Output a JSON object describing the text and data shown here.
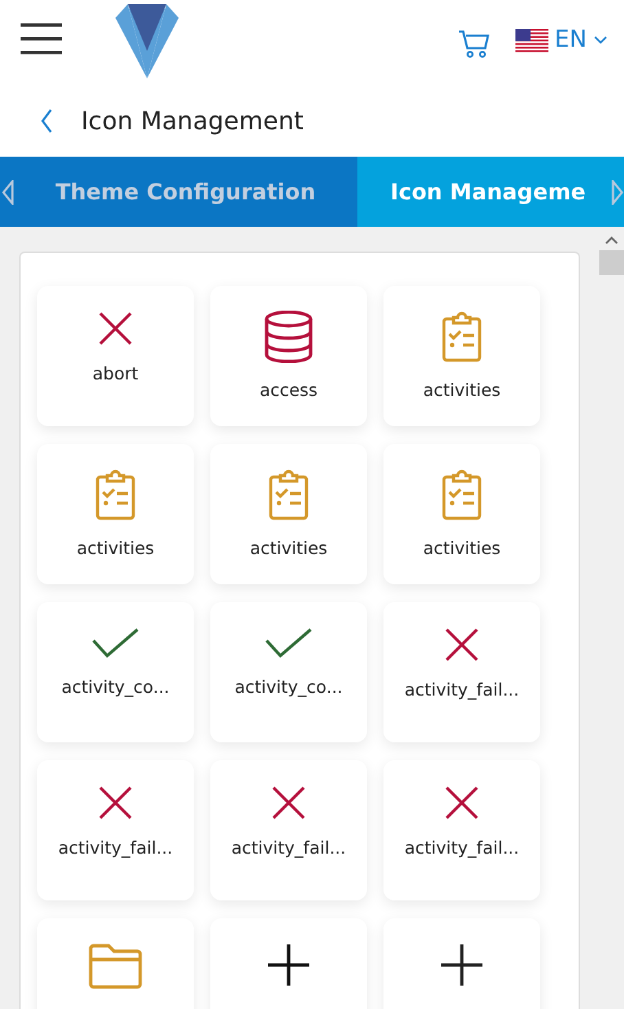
{
  "header": {
    "language": "EN"
  },
  "breadcrumb": {
    "title": "Icon Management"
  },
  "tabs": [
    {
      "label": "Theme Configuration",
      "selected": false
    },
    {
      "label": "Icon Manageme",
      "selected": true
    }
  ],
  "icons": [
    {
      "kind": "cross",
      "color": "#b5103c",
      "label": "abort"
    },
    {
      "kind": "database",
      "color": "#b5103c",
      "label": "access"
    },
    {
      "kind": "clipboard",
      "color": "#d4982a",
      "label": "activities"
    },
    {
      "kind": "clipboard",
      "color": "#d4982a",
      "label": "activities"
    },
    {
      "kind": "clipboard",
      "color": "#d4982a",
      "label": "activities"
    },
    {
      "kind": "clipboard",
      "color": "#d4982a",
      "label": "activities"
    },
    {
      "kind": "check",
      "color": "#2e6b35",
      "label": "activity_co..."
    },
    {
      "kind": "check",
      "color": "#2e6b35",
      "label": "activity_co..."
    },
    {
      "kind": "cross",
      "color": "#b5103c",
      "label": "activity_fail..."
    },
    {
      "kind": "cross",
      "color": "#b5103c",
      "label": "activity_fail..."
    },
    {
      "kind": "cross",
      "color": "#b5103c",
      "label": "activity_fail..."
    },
    {
      "kind": "cross",
      "color": "#b5103c",
      "label": "activity_fail..."
    },
    {
      "kind": "folder",
      "color": "#d4982a"
    },
    {
      "kind": "plus",
      "color": "#111111"
    },
    {
      "kind": "plus",
      "color": "#222222"
    }
  ]
}
